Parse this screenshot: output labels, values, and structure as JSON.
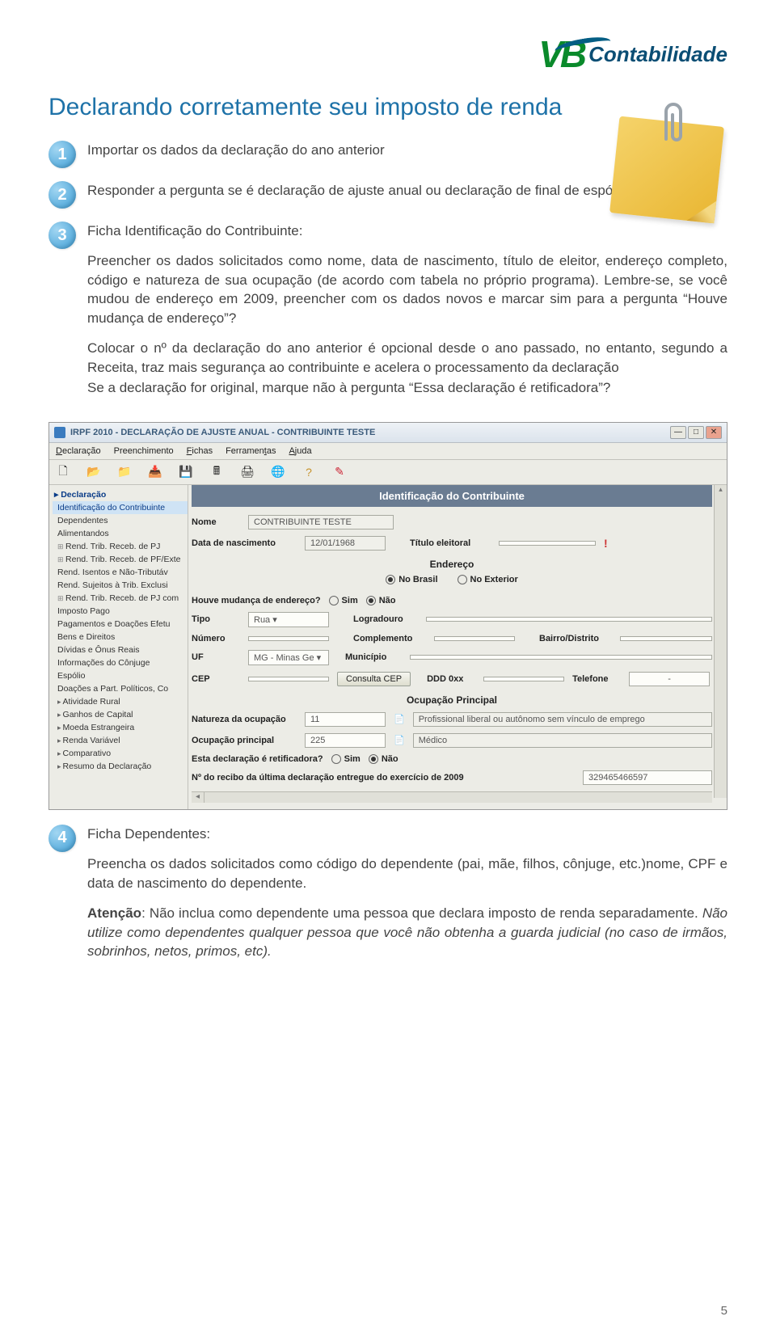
{
  "logo": {
    "abbrev": "VB",
    "text": "Contabilidade"
  },
  "title": "Declarando corretamente seu imposto de renda",
  "step1": {
    "num": "1",
    "text": "Importar os dados da declaração do ano anterior"
  },
  "step2": {
    "num": "2",
    "text": "Responder a pergunta se é declaração de ajuste anual ou declaração de final de espólio"
  },
  "step3": {
    "num": "3",
    "heading": "Ficha Identificação do Contribuinte:",
    "p1": "Preencher os dados solicitados como nome, data de nascimento, título de eleitor, endereço completo, código e natureza de sua ocupação (de acordo com tabela no próprio programa). Lembre-se, se você mudou de endereço em 2009, preencher com os dados novos e marcar sim para a pergunta “Houve mudança de endereço”?",
    "p2": "Colocar o nº da declaração do ano anterior é opcional desde o ano passado, no entanto, segundo a Receita, traz mais segurança ao contribuinte e acelera o processamento da declaração",
    "p3": "Se a declaração for original, marque não à pergunta “Essa declaração é retificadora”?"
  },
  "step4": {
    "num": "4",
    "heading": "Ficha Dependentes:",
    "p1": "Preencha os dados solicitados como código do dependente (pai, mãe, filhos, cônjuge, etc.)nome, CPF e data de nascimento do dependente.",
    "p2a": "Atenção",
    "p2b": ": Não inclua como dependente uma pessoa que declara imposto de renda separadamente. ",
    "p2c": "Não utilize como dependentes qualquer pessoa que você não obtenha a guarda judicial (no caso de irmãos, sobrinhos, netos, primos, etc)."
  },
  "app": {
    "title": "IRPF 2010 - DECLARAÇÃO DE AJUSTE ANUAL - CONTRIBUINTE TESTE",
    "menus": {
      "m1": "Declaração",
      "m2": "Preenchimento",
      "m3": "Fichas",
      "m4": "Ferramentas",
      "m5": "Ajuda"
    },
    "sidebar": {
      "head": "Declaração",
      "items": [
        "Identificação do Contribuinte",
        "Dependentes",
        "Alimentandos",
        "Rend. Trib. Receb. de PJ",
        "Rend. Trib. Receb. de PF/Exte",
        "Rend. Isentos e Não-Tributáv",
        "Rend. Sujeitos à Trib. Exclusi",
        "Rend. Trib. Receb. de PJ com",
        "Imposto Pago",
        "Pagamentos e Doações Efetu",
        "Bens e Direitos",
        "Dívidas e Ônus Reais",
        "Informações do Cônjuge",
        "Espólio",
        "Doações a Part. Políticos, Co",
        "Atividade Rural",
        "Ganhos de Capital",
        "Moeda Estrangeira",
        "Renda Variável",
        "Comparativo",
        "Resumo da Declaração"
      ]
    },
    "panel": {
      "title": "Identificação do Contribuinte",
      "nome_lbl": "Nome",
      "nome_val": "CONTRIBUINTE TESTE",
      "dn_lbl": "Data de nascimento",
      "dn_val": "12/01/1968",
      "titulo_lbl": "Título eleitoral",
      "endereco_head": "Endereço",
      "nobrasil": "No Brasil",
      "noexterior": "No Exterior",
      "mudanca_lbl": "Houve mudança de endereço?",
      "sim": "Sim",
      "nao": "Não",
      "tipo_lbl": "Tipo",
      "tipo_val": "Rua",
      "logradouro_lbl": "Logradouro",
      "numero_lbl": "Número",
      "complemento_lbl": "Complemento",
      "bairro_lbl": "Bairro/Distrito",
      "uf_lbl": "UF",
      "uf_val": "MG - Minas Ge",
      "municipio_lbl": "Município",
      "cep_lbl": "CEP",
      "consulta_cep": "Consulta CEP",
      "ddd_lbl": "DDD 0xx",
      "tel_lbl": "Telefone",
      "tel_val": "-",
      "ocup_head": "Ocupação Principal",
      "nat_lbl": "Natureza da ocupação",
      "nat_code": "11",
      "nat_desc": "Profissional liberal ou autônomo sem vínculo de emprego",
      "ocup_lbl": "Ocupação principal",
      "ocup_code": "225",
      "ocup_desc": "Médico",
      "retif_lbl": "Esta declaração é retificadora?",
      "recibo_lbl": "Nº do recibo da última declaração entregue do exercício de 2009",
      "recibo_val": "329465466597"
    }
  },
  "page_number": "5"
}
